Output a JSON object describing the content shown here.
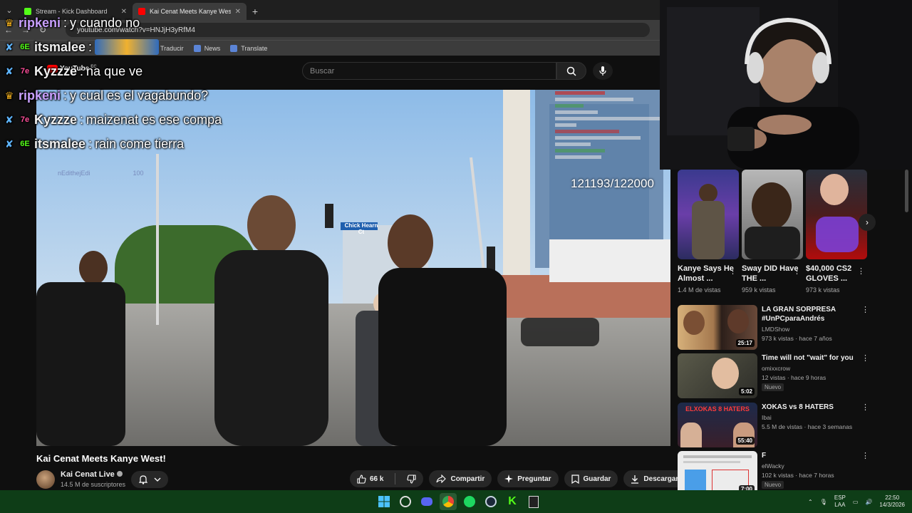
{
  "browser": {
    "tabs": [
      {
        "title": "Stream - Kick Dashboard",
        "favicon_color": "#53fc18"
      },
      {
        "title": "Kai Cenat Meets Kanye West! -",
        "favicon_color": "#ff0000"
      }
    ],
    "url": "youtube.com/watch?v=HNJjH3yRfM4",
    "bookmarks": [
      "Traducir",
      "News",
      "Translate"
    ]
  },
  "youtube": {
    "logo_text": "YouTube",
    "country": "EC",
    "search_placeholder": "Buscar",
    "video": {
      "title": "Kai Cenat Meets Kanye West!",
      "channel": "Kai Cenat Live",
      "subscribers": "14.5 M de suscriptores",
      "likes": "66 k",
      "share_label": "Compartir",
      "ask_label": "Preguntar",
      "save_label": "Guardar",
      "download_label": "Descargar",
      "overlay": {
        "counter": "121193/122000",
        "sign": "Chick Hearn Ct",
        "ghost_user": "nEdithejEdi",
        "ghost_amount": "100"
      }
    },
    "shorts": [
      {
        "title": "Kanye Says He Almost ...",
        "views": "1.4 M de vistas"
      },
      {
        "title": "Sway DID Have THE ...",
        "views": "959 k vistas"
      },
      {
        "title": "$40,000 CS2 GLOVES ...",
        "views": "973 k vistas"
      }
    ],
    "recommendations": [
      {
        "title": "LA GRAN SORPRESA #UnPCparaAndrés",
        "channel": "LMDShow",
        "meta": "973 k vistas · hace 7 años",
        "duration": "25:17",
        "badge": ""
      },
      {
        "title": "Time will not \"wait\" for you",
        "channel": "omixxcrow",
        "meta": "12 vistas · hace 9 horas",
        "duration": "5:02",
        "badge": "Nuevo"
      },
      {
        "title": "XOKAS vs 8 HATERS",
        "channel": "Ibai",
        "meta": "5.5 M de vistas · hace 3 semanas",
        "duration": "55:40",
        "badge": ""
      },
      {
        "title": "F",
        "channel": "elWacky",
        "meta": "102 k vistas · hace 7 horas",
        "duration": "7:00",
        "badge": "Nuevo"
      }
    ],
    "rec_thumb_text": "ELXOKAS 8 HATERS"
  },
  "chat": [
    {
      "user": "ripkeni",
      "text": "y cuando no",
      "color": "#c9a0ff",
      "badge": "crown"
    },
    {
      "user": "itsmalee",
      "text": "",
      "color": "#ffffff",
      "badge": "sword"
    },
    {
      "user": "Kyzzze",
      "text": "na que ve",
      "color": "#ffffff",
      "badge": "sword"
    },
    {
      "user": "ripkeni",
      "text": "y cual es el vagabundo?",
      "color": "#c9a0ff",
      "badge": "crown"
    },
    {
      "user": "Kyzzze",
      "text": "maizenat es ese compa",
      "color": "#ffffff",
      "badge": "sword"
    },
    {
      "user": "itsmalee",
      "text": "rain come tierra",
      "color": "#ffffff",
      "badge": "sword"
    }
  ],
  "taskbar": {
    "lang": "ESP",
    "lang2": "LAA",
    "time": "22:50",
    "date": "14/3/2026",
    "accent": "#0e3d17"
  }
}
